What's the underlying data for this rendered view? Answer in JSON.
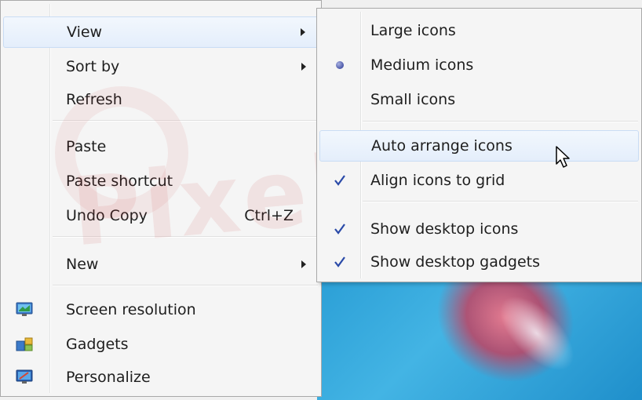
{
  "context_menu": {
    "items": [
      {
        "label": "View"
      },
      {
        "label": "Sort by"
      },
      {
        "label": "Refresh"
      },
      {
        "label": "Paste"
      },
      {
        "label": "Paste shortcut"
      },
      {
        "label": "Undo Copy",
        "shortcut": "Ctrl+Z"
      },
      {
        "label": "New"
      },
      {
        "label": "Screen resolution"
      },
      {
        "label": "Gadgets"
      },
      {
        "label": "Personalize"
      }
    ]
  },
  "view_submenu": {
    "items": [
      {
        "label": "Large icons",
        "checked": false
      },
      {
        "label": "Medium icons",
        "selected": true
      },
      {
        "label": "Small icons",
        "checked": false
      },
      {
        "label": "Auto arrange icons",
        "checked": false
      },
      {
        "label": "Align icons to grid",
        "checked": true
      },
      {
        "label": "Show desktop icons",
        "checked": true
      },
      {
        "label": "Show desktop gadgets",
        "checked": true
      }
    ]
  },
  "watermark": {
    "text": "PixelStreamz.ir"
  },
  "colors": {
    "menu_bg": "#f5f5f5",
    "hover_bg": "#e4eefb",
    "hover_border": "#c9dcf4",
    "check": "#2a4aa8",
    "wallpaper": "#2b9fd6"
  }
}
